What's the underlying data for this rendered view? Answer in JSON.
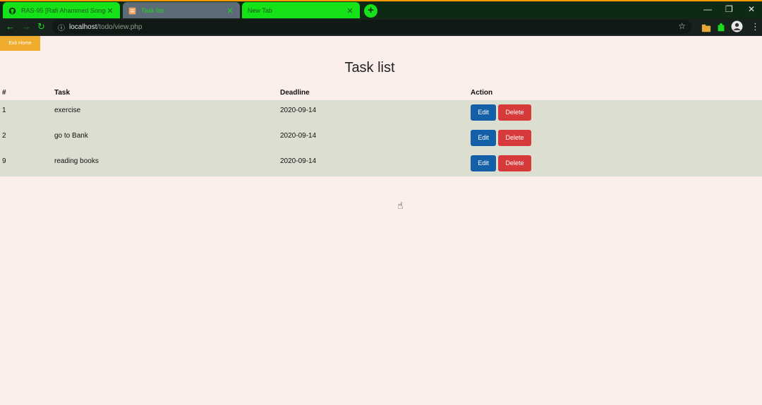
{
  "tabs": [
    {
      "title": "RAS-95 [Rafi Ahammed Songrat",
      "close": "✕"
    },
    {
      "title": "Task list",
      "close": "✕"
    },
    {
      "title": "New Tab",
      "close": "✕"
    }
  ],
  "newtab_label": "+",
  "window_controls": {
    "minimize": "—",
    "maximize": "❐",
    "close": "✕"
  },
  "address": {
    "host": "localhost",
    "path": "/todo/view.php"
  },
  "page": {
    "exit_label": "Exit Home",
    "title": "Task list",
    "columns": [
      "#",
      "Task",
      "Deadline",
      "Action"
    ],
    "rows": [
      {
        "num": "1",
        "task": "exercise",
        "deadline": "2020-09-14"
      },
      {
        "num": "2",
        "task": "go to Bank",
        "deadline": "2020-09-14"
      },
      {
        "num": "9",
        "task": "reading books",
        "deadline": "2020-09-14"
      }
    ],
    "edit_label": "Edit",
    "delete_label": "Delete"
  },
  "colors": {
    "tab_accent": "#16e21a",
    "edit": "#1460a8",
    "delete": "#d73a3b",
    "exit": "#f0ad2d",
    "page_bg": "#fbeeeb",
    "row_bg": "#dcded0"
  }
}
